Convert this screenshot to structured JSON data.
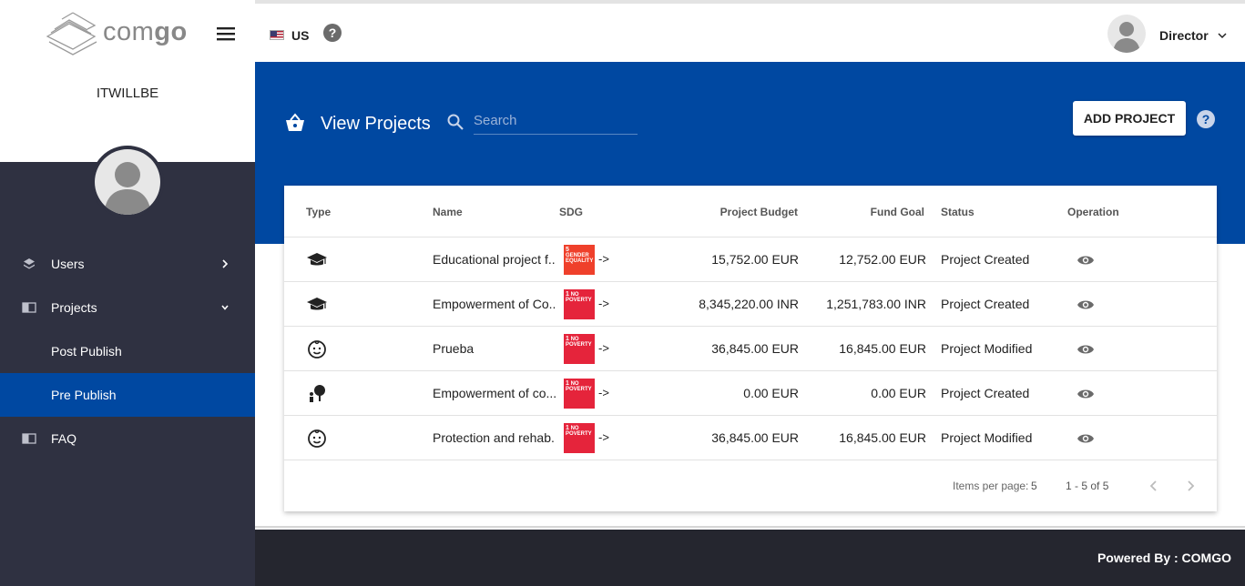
{
  "brand": {
    "name_light": "com",
    "name_bold": "go",
    "org": "ITWILLBE"
  },
  "sidebar": {
    "items": [
      {
        "label": "Users",
        "icon": "layers-icon"
      },
      {
        "label": "Projects",
        "icon": "book-icon"
      },
      {
        "label": "Post Publish"
      },
      {
        "label": "Pre Publish"
      },
      {
        "label": "FAQ",
        "icon": "book-icon"
      }
    ]
  },
  "topbar": {
    "country": "US",
    "role": "Director"
  },
  "header": {
    "title": "View Projects",
    "search_placeholder": "Search",
    "add_button": "ADD PROJECT"
  },
  "table": {
    "columns": [
      "Type",
      "Name",
      "SDG",
      "Project Budget",
      "Fund Goal",
      "Status",
      "Operation"
    ],
    "rows": [
      {
        "type_icon": "graduation-cap-icon",
        "name": "Educational project f...",
        "sdg_num": "5",
        "sdg_text": "GENDER EQUALITY",
        "sdg_color": "#ef402b",
        "arrow": "->",
        "budget": "15,752.00 EUR",
        "goal": "12,752.00 EUR",
        "status": "Project Created"
      },
      {
        "type_icon": "graduation-cap-icon",
        "name": "Empowerment of Co...",
        "sdg_num": "1",
        "sdg_text": "NO POVERTY",
        "sdg_color": "#e5243b",
        "arrow": "->",
        "budget": "8,345,220.00 INR",
        "goal": "1,251,783.00 INR",
        "status": "Project Created"
      },
      {
        "type_icon": "child-face-icon",
        "name": "Prueba",
        "sdg_num": "1",
        "sdg_text": "NO POVERTY",
        "sdg_color": "#e5243b",
        "arrow": "->",
        "budget": "36,845.00 EUR",
        "goal": "16,845.00 EUR",
        "status": "Project Modified"
      },
      {
        "type_icon": "tree-person-icon",
        "name": "Empowerment of co...",
        "sdg_num": "1",
        "sdg_text": "NO POVERTY",
        "sdg_color": "#e5243b",
        "arrow": "->",
        "budget": "0.00 EUR",
        "goal": "0.00 EUR",
        "status": "Project Created"
      },
      {
        "type_icon": "child-face-icon",
        "name": "Protection and rehab...",
        "sdg_num": "1",
        "sdg_text": "NO POVERTY",
        "sdg_color": "#e5243b",
        "arrow": "->",
        "budget": "36,845.00 EUR",
        "goal": "16,845.00 EUR",
        "status": "Project Modified"
      }
    ]
  },
  "pager": {
    "label": "Items per page:",
    "size": "5",
    "range": "1 - 5 of 5"
  },
  "footer": {
    "text": "Powered By : COMGO"
  },
  "colors": {
    "primary": "#0048a1",
    "sidebar": "#2f3141",
    "footer": "#25262f",
    "sdg_red": "#e5243b"
  }
}
